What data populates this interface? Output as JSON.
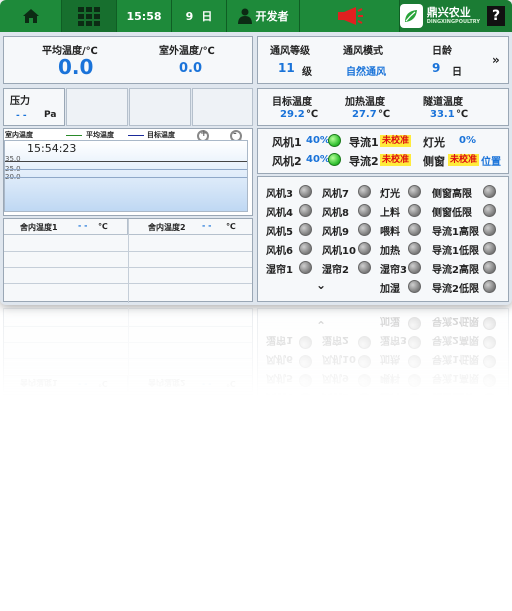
{
  "topbar": {
    "time": "15:58",
    "day_number": "9",
    "day_unit": "日",
    "user": "开发者",
    "logo_text": "鼎兴农业",
    "logo_subtext": "DINGXINGPOULTRY",
    "help_label": "?"
  },
  "temps": {
    "avg_label": "平均温度/℃",
    "avg_value": "0.0",
    "outdoor_label": "室外温度/℃",
    "outdoor_value": "0.0"
  },
  "vent": {
    "level_label": "通风等级",
    "level_value": "11",
    "level_unit": "级",
    "mode_label": "通风模式",
    "mode_value": "自然通风",
    "age_label": "日龄",
    "age_value": "9",
    "age_unit": "日",
    "more_label": "»"
  },
  "pressure": {
    "label": "压力",
    "value": "- -",
    "unit": "Pa"
  },
  "target": {
    "target_label": "目标温度",
    "target_value": "29.2",
    "heat_label": "加热温度",
    "heat_value": "27.7",
    "tunnel_label": "隧道温度",
    "tunnel_value": "33.1",
    "unit": "℃"
  },
  "chart": {
    "title": "室内温度",
    "legend_avg": "平均温度",
    "legend_target": "目标温度",
    "timestamp": "15:54:23",
    "ticks": [
      "35.0",
      "25.0",
      "20.0"
    ]
  },
  "indoor": {
    "label1": "舍内温度1",
    "value1": "- -",
    "label2": "舍内温度2",
    "value2": "- -",
    "unit": "℃"
  },
  "status": {
    "fan1_label": "风机1",
    "fan1_value": "40%",
    "fan2_label": "风机2",
    "fan2_value": "40%",
    "guide1_label": "导流1",
    "guide1_badge": "未校准",
    "guide2_label": "导流2",
    "guide2_badge": "未校准",
    "light_label": "灯光",
    "light_value": "0%",
    "side_label": "侧窗",
    "side_badge": "未校准",
    "position_label": "位置"
  },
  "devices": {
    "col1": [
      "风机3",
      "风机4",
      "风机5",
      "风机6",
      "湿帘1"
    ],
    "col2": [
      "风机7",
      "风机8",
      "风机9",
      "风机10",
      "湿帘2"
    ],
    "col3": [
      "灯光",
      "上料",
      "喂料",
      "加热",
      "湿帘3",
      "加湿"
    ],
    "col4": [
      "侧窗高限",
      "侧窗低限",
      "导流1高限",
      "导流1低限",
      "导流2高限",
      "导流2低限"
    ],
    "more_label": "⌄"
  },
  "colors": {
    "topbar": "#1e8a3a",
    "accent_blue": "#1a73d9",
    "lamp_on": "#2fbf2f",
    "badge_bg": "#ffeb3b",
    "badge_text": "#dd1111"
  }
}
